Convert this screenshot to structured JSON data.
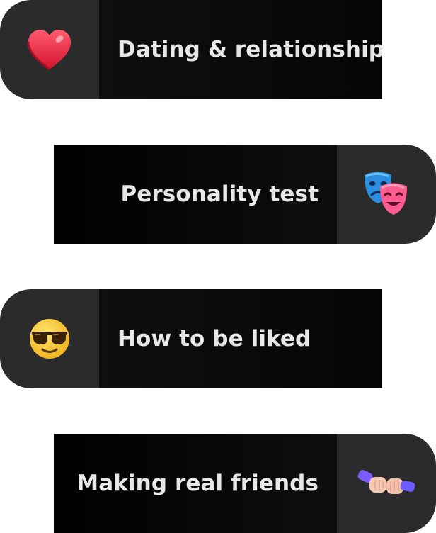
{
  "topics": [
    {
      "label": "Dating & relationships",
      "icon": "heart-icon"
    },
    {
      "label": "Personality test",
      "icon": "theater-masks-icon"
    },
    {
      "label": "How to be liked",
      "icon": "smiling-face-with-sunglasses-icon"
    },
    {
      "label": "Making real friends",
      "icon": "fist-bump-icon"
    }
  ],
  "colors": {
    "icon_panel": "#2b2b2b",
    "label_panel": "#050505",
    "text": "#e8e8e8"
  }
}
